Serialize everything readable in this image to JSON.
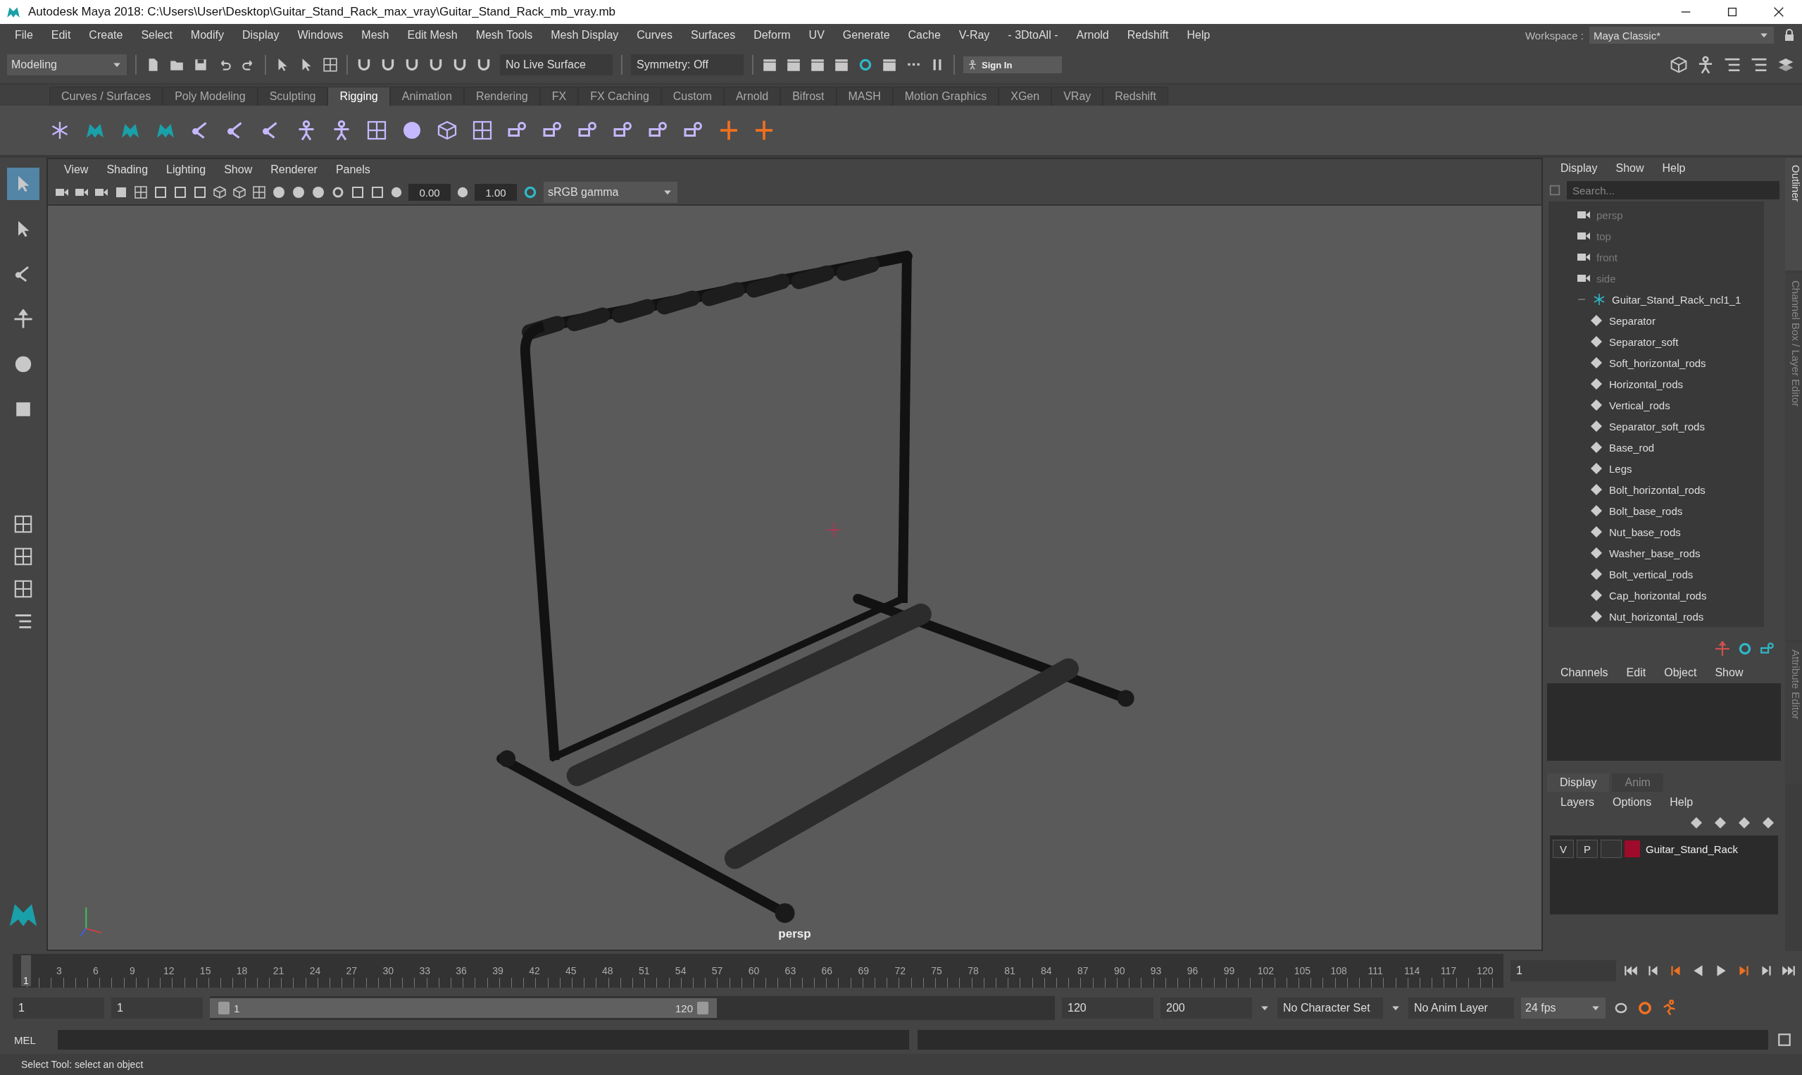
{
  "window": {
    "title": "Autodesk Maya 2018: C:\\Users\\User\\Desktop\\Guitar_Stand_Rack_max_vray\\Guitar_Stand_Rack_mb_vray.mb"
  },
  "menu_bar": [
    "File",
    "Edit",
    "Create",
    "Select",
    "Modify",
    "Display",
    "Windows",
    "Mesh",
    "Edit Mesh",
    "Mesh Tools",
    "Mesh Display",
    "Curves",
    "Surfaces",
    "Deform",
    "UV",
    "Generate",
    "Cache",
    "V-Ray",
    "- 3DtoAll -",
    "Arnold",
    "Redshift",
    "Help"
  ],
  "workspace": {
    "label": "Workspace :",
    "value": "Maya Classic*"
  },
  "status_line": {
    "menu_set": "Modeling",
    "live_surface": "No Live Surface",
    "symmetry": "Symmetry: Off",
    "sign_in": "Sign In"
  },
  "shelf_tabs": [
    {
      "label": "Curves / Surfaces",
      "selected": false
    },
    {
      "label": "Poly Modeling",
      "selected": false
    },
    {
      "label": "Sculpting",
      "selected": false
    },
    {
      "label": "Rigging",
      "selected": true
    },
    {
      "label": "Animation",
      "selected": false
    },
    {
      "label": "Rendering",
      "selected": false
    },
    {
      "label": "FX",
      "selected": false
    },
    {
      "label": "FX Caching",
      "selected": false
    },
    {
      "label": "Custom",
      "selected": false
    },
    {
      "label": "Arnold",
      "selected": false
    },
    {
      "label": "Bifrost",
      "selected": false
    },
    {
      "label": "MASH",
      "selected": false
    },
    {
      "label": "Motion Graphics",
      "selected": false
    },
    {
      "label": "XGen",
      "selected": false
    },
    {
      "label": "VRay",
      "selected": false
    },
    {
      "label": "Redshift",
      "selected": false
    }
  ],
  "viewport": {
    "menu": [
      "View",
      "Shading",
      "Lighting",
      "Show",
      "Renderer",
      "Panels"
    ],
    "exposure": "0.00",
    "gamma": "1.00",
    "color_space": "sRGB gamma",
    "camera_label": "persp"
  },
  "outliner": {
    "menu": [
      "Display",
      "Show",
      "Help"
    ],
    "search": {
      "placeholder": "Search..."
    },
    "tab_label": "Outliner",
    "items": [
      {
        "label": "persp",
        "kind": "camera"
      },
      {
        "label": "top",
        "kind": "camera"
      },
      {
        "label": "front",
        "kind": "camera"
      },
      {
        "label": "side",
        "kind": "camera"
      },
      {
        "label": "Guitar_Stand_Rack_ncl1_1",
        "kind": "group",
        "expanded": true,
        "children": [
          {
            "label": "Separator",
            "kind": "mesh"
          },
          {
            "label": "Separator_soft",
            "kind": "mesh"
          },
          {
            "label": "Soft_horizontal_rods",
            "kind": "mesh"
          },
          {
            "label": "Horizontal_rods",
            "kind": "mesh"
          },
          {
            "label": "Vertical_rods",
            "kind": "mesh"
          },
          {
            "label": "Separator_soft_rods",
            "kind": "mesh"
          },
          {
            "label": "Base_rod",
            "kind": "mesh"
          },
          {
            "label": "Legs",
            "kind": "mesh"
          },
          {
            "label": "Bolt_horizontal_rods",
            "kind": "mesh"
          },
          {
            "label": "Bolt_base_rods",
            "kind": "mesh"
          },
          {
            "label": "Nut_base_rods",
            "kind": "mesh"
          },
          {
            "label": "Washer_base_rods",
            "kind": "mesh"
          },
          {
            "label": "Bolt_vertical_rods",
            "kind": "mesh"
          },
          {
            "label": "Cap_horizontal_rods",
            "kind": "mesh"
          },
          {
            "label": "Nut_horizontal_rods",
            "kind": "mesh"
          }
        ]
      }
    ]
  },
  "channel_box": {
    "menu": [
      "Channels",
      "Edit",
      "Object",
      "Show"
    ],
    "tab_label": "Channel Box / Layer Editor"
  },
  "layer_editor": {
    "tabs": [
      {
        "label": "Display",
        "selected": true
      },
      {
        "label": "Anim",
        "selected": false
      }
    ],
    "menu": [
      "Layers",
      "Options",
      "Help"
    ],
    "layers": [
      {
        "visible": "V",
        "playback": "P",
        "color": "#9e0b2b",
        "name": "Guitar_Stand_Rack"
      }
    ]
  },
  "attribute_tab": "Attribute Editor",
  "timeline": {
    "current": "1",
    "level": 0,
    "ticks": [
      "3",
      "6",
      "9",
      "12",
      "15",
      "18",
      "21",
      "24",
      "27",
      "30",
      "33",
      "36",
      "39",
      "42",
      "45",
      "48",
      "51",
      "54",
      "57",
      "60",
      "63",
      "66",
      "69",
      "72",
      "75",
      "78",
      "81",
      "84",
      "87",
      "90",
      "93",
      "96",
      "99",
      "102",
      "105",
      "108",
      "111",
      "114",
      "117",
      "120"
    ],
    "frame_field": "1"
  },
  "range": {
    "level": 0.6,
    "start": "1",
    "playback_start": "1",
    "slider_start": "1",
    "slider_end": "120",
    "playback_end": "120",
    "end": "200",
    "character_set": "No Character Set",
    "anim_layer": "No Anim Layer",
    "fps": "24 fps"
  },
  "command_line": {
    "label": "MEL"
  },
  "help_line": "Select Tool: select an object"
}
